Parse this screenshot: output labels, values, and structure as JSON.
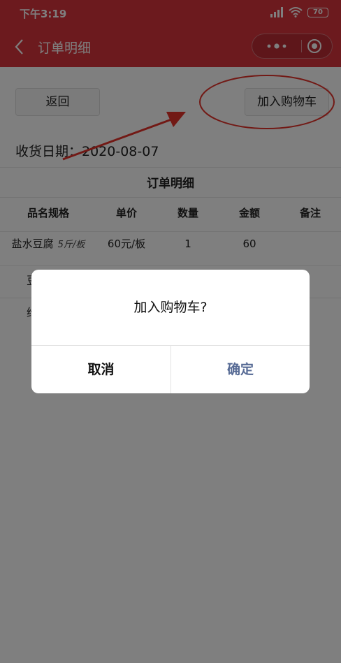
{
  "status_bar": {
    "time": "下午3:19",
    "battery": "70",
    "signal_icon": "signal-icon",
    "wifi_icon": "wifi-icon"
  },
  "nav": {
    "title": "订单明细",
    "back_icon": "chevron-left-icon",
    "more_icon": "more-dots-icon",
    "close_icon": "target-circle-icon"
  },
  "toolbar": {
    "back_label": "返回",
    "add_to_cart_label": "加入购物车"
  },
  "receipt_date": "收货日期：2020-08-07",
  "section_title": "订单明细",
  "table": {
    "headers": [
      "品名规格",
      "单价",
      "数量",
      "金额",
      "备注"
    ],
    "rows": [
      {
        "name": "盐水豆腐",
        "spec": "5斤/板",
        "unit_price": "60元/板",
        "quantity": "1",
        "amount": "60",
        "note": ""
      }
    ],
    "obscured_rows": [
      "豆",
      "给"
    ]
  },
  "dialog": {
    "message": "加入购物车?",
    "cancel_label": "取消",
    "confirm_label": "确定"
  },
  "colors": {
    "brand_red": "#d8343d",
    "annotation_red": "#e5332a",
    "confirm_blue": "#576b95"
  }
}
